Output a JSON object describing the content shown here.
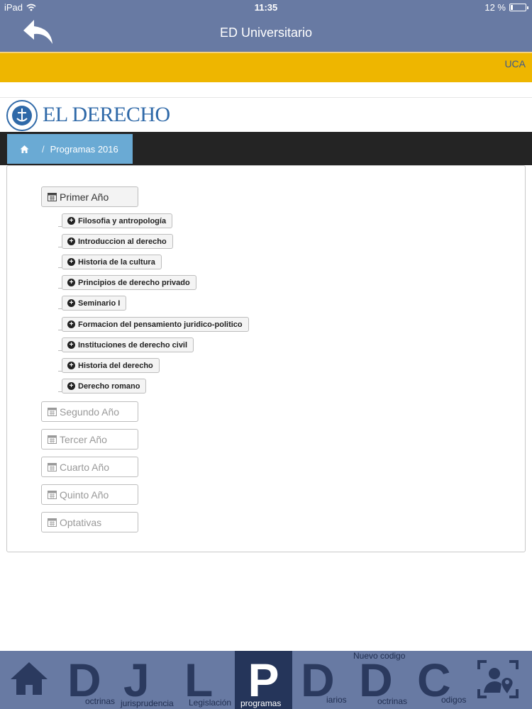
{
  "status_bar": {
    "device": "iPad",
    "time": "11:35",
    "battery": "12 %"
  },
  "nav": {
    "title": "ED Universitario"
  },
  "band": {
    "label": "UCA"
  },
  "brand": {
    "logo_text": "EL DERECHO"
  },
  "breadcrumb": {
    "separator": "/",
    "current": "Programas 2016"
  },
  "years": [
    {
      "label": "Primer Año",
      "expanded": true,
      "courses": [
        "Filosofia y antropología",
        "Introduccion al derecho",
        "Historia de la cultura",
        "Principios de derecho privado",
        "Seminario I",
        "Formacion del pensamiento juridico-politico",
        "Instituciones de derecho civil",
        "Historia del derecho",
        "Derecho romano"
      ]
    },
    {
      "label": "Segundo Año",
      "expanded": false
    },
    {
      "label": "Tercer Año",
      "expanded": false
    },
    {
      "label": "Cuarto Año",
      "expanded": false
    },
    {
      "label": "Quinto Año",
      "expanded": false
    },
    {
      "label": "Optativas",
      "expanded": false
    }
  ],
  "tabs": [
    {
      "glyph": "",
      "icon": "home-icon",
      "label": ""
    },
    {
      "glyph": "D",
      "label": "octrinas"
    },
    {
      "glyph": "J",
      "label": "jurisprudencia"
    },
    {
      "glyph": "L",
      "label": "Legislación"
    },
    {
      "glyph": "P",
      "label": "programas",
      "active": true
    },
    {
      "glyph": "D",
      "label": "iarios"
    },
    {
      "glyph": "D",
      "label": "octrinas",
      "top_label": "Nuevo codigo"
    },
    {
      "glyph": "C",
      "label": "odigos"
    },
    {
      "glyph": "",
      "icon": "profile-location-icon",
      "label": ""
    }
  ],
  "colors": {
    "header": "#687aa3",
    "band": "#eeb600",
    "breadcrumb_active": "#6aaad4",
    "tab_active": "#25355a",
    "brand_blue": "#2f69a8"
  }
}
